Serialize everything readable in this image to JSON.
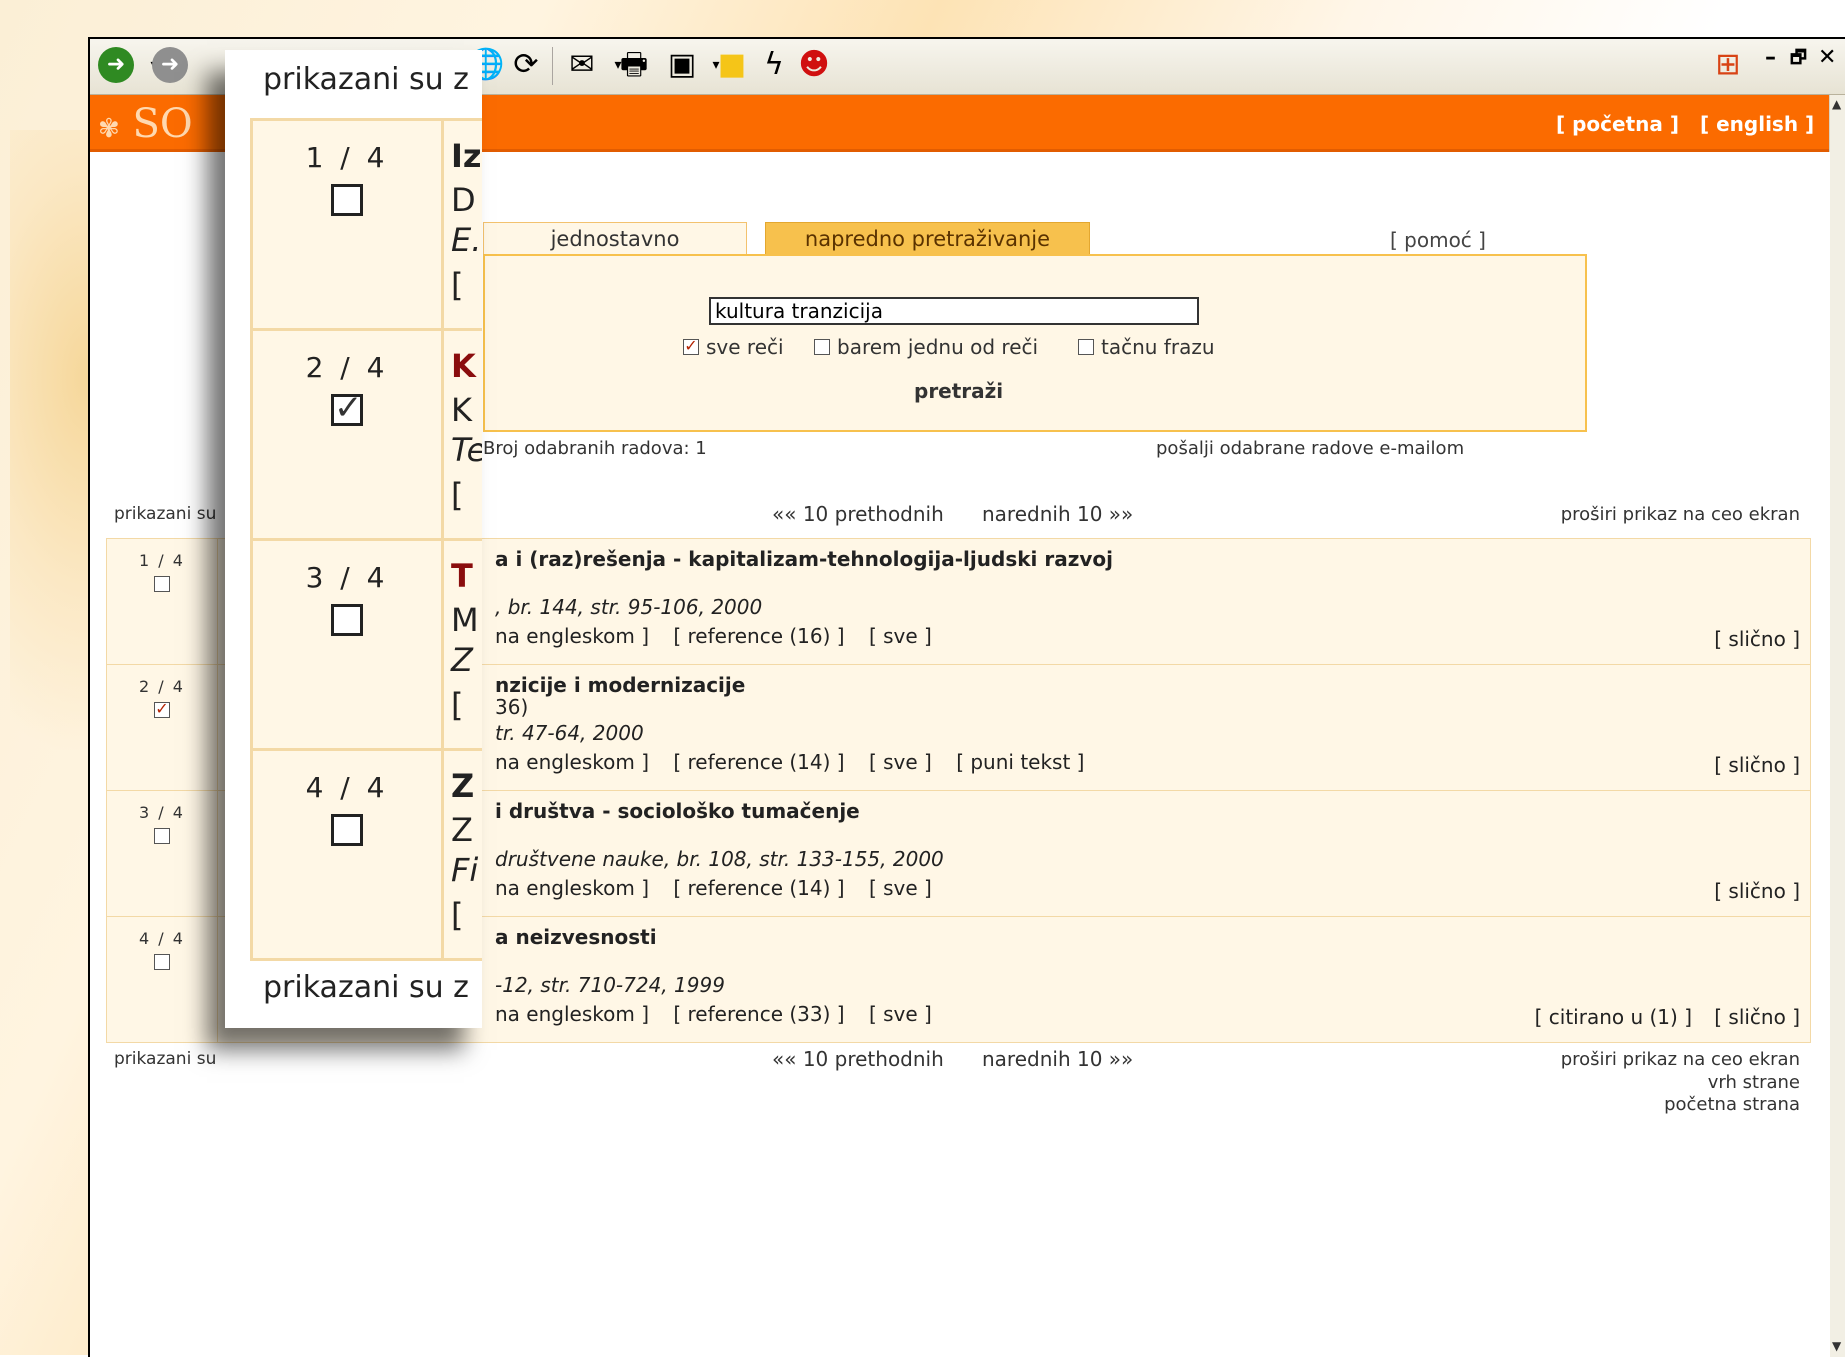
{
  "toolbar": {
    "icons": [
      "back-arrow",
      "forward-arrow",
      "favorites-star",
      "globe",
      "msn",
      "mail",
      "print",
      "edit",
      "note",
      "flash",
      "messenger"
    ]
  },
  "header": {
    "logo": "SO",
    "home_link": "[ početna ]",
    "english_link": "[ english ]"
  },
  "search": {
    "tab_simple": "jednostavno pretraživanje",
    "tab_advanced": "napredno pretraživanje",
    "help": "[ pomoć ]",
    "query": "kultura tranzicija",
    "options": [
      {
        "label": "sve reči",
        "checked": true
      },
      {
        "label": "barem jednu od reči",
        "checked": false
      },
      {
        "label": "tačnu frazu",
        "checked": false
      }
    ],
    "submit": "pretraži",
    "selected_count": "Broj odabranih radova: 1",
    "send_selected": "pošalji odabrane radove e-mailom"
  },
  "pager": {
    "prev": "«« 10 prethodnih",
    "next": "narednih 10 »»",
    "expand": "proširi prikaz na ceo ekran",
    "top": "vrh strane",
    "home": "početna strana",
    "shown_text": "prikazani su"
  },
  "results": [
    {
      "num": "1 / 4",
      "checked": false,
      "title": "a i (raz)rešenja - kapitalizam-tehnologija-ljudski razvoj",
      "sub": "",
      "source": ", br. 144, str. 95-106, 2000",
      "links": [
        "na engleskom ]",
        "[ reference (16) ]",
        "[ sve ]"
      ],
      "cited": "",
      "similar": "[ slično ]"
    },
    {
      "num": "2 / 4",
      "checked": true,
      "title": "nzicije i modernizacije",
      "sub": "36)",
      "source": "tr. 47-64, 2000",
      "links": [
        "na engleskom ]",
        "[ reference (14) ]",
        "[ sve ]",
        "[ puni tekst ]"
      ],
      "cited": "",
      "similar": "[ slično ]"
    },
    {
      "num": "3 / 4",
      "checked": false,
      "title": "i društva - sociološko tumačenje",
      "sub": "",
      "source": " društvene nauke, br. 108, str. 133-155, 2000",
      "links": [
        "na engleskom ]",
        "[ reference (14) ]",
        "[ sve ]"
      ],
      "cited": "",
      "similar": "[ slično ]"
    },
    {
      "num": "4 / 4",
      "checked": false,
      "title": "a neizvesnosti",
      "sub": "",
      "source": "-12, str. 710-724, 1999",
      "links": [
        "na engleskom ]",
        "[ reference (33) ]",
        "[ sve ]"
      ],
      "cited": "[ citirano u (1) ]",
      "similar": "[ slično ]"
    }
  ],
  "zoom": {
    "header": "prikazani su z",
    "footer": "prikazani su z",
    "rows": [
      {
        "num": "1 / 4",
        "checked": false,
        "frags": [
          "Iz",
          "D",
          "E.",
          "["
        ],
        "frag_colors": [
          "#222",
          "#222",
          "#222",
          "#222"
        ]
      },
      {
        "num": "2 / 4",
        "checked": true,
        "frags": [
          "K",
          "K",
          "Te",
          "["
        ],
        "frag_colors": [
          "#8a0d0d",
          "#222",
          "#222",
          "#222"
        ]
      },
      {
        "num": "3 / 4",
        "checked": false,
        "frags": [
          "T",
          "M",
          "Z",
          "["
        ],
        "frag_colors": [
          "#8a0d0d",
          "#222",
          "#222",
          "#222"
        ]
      },
      {
        "num": "4 / 4",
        "checked": false,
        "frags": [
          "Z",
          "Z",
          "Fi",
          "["
        ],
        "frag_colors": [
          "#222",
          "#222",
          "#222",
          "#222"
        ]
      }
    ]
  },
  "colors": {
    "header_orange": "#fb6b00",
    "tab_yellow": "#f7c14d",
    "panel_bg": "#fff7e6"
  }
}
